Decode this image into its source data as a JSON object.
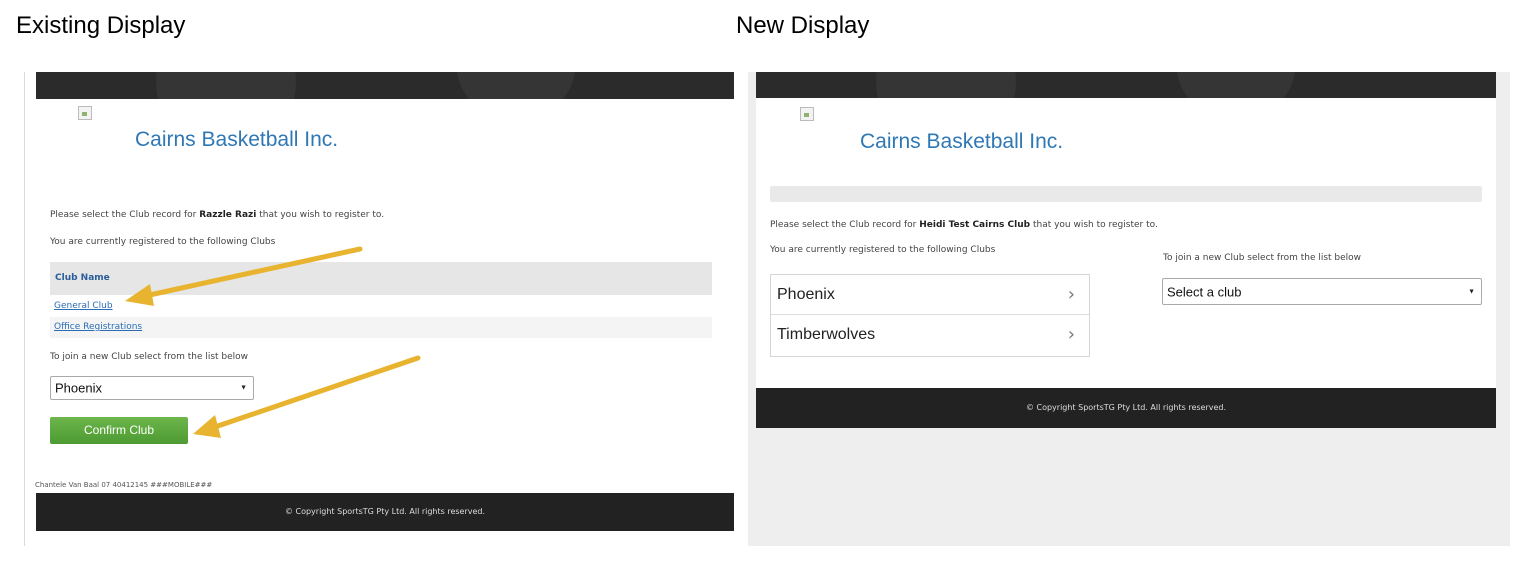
{
  "captions": {
    "left": "Existing Display",
    "right": "New Display"
  },
  "existing": {
    "brand": "Cairns Basketball Inc.",
    "intro_prefix": "Please select the Club record for ",
    "intro_name": "Razzle Razi",
    "intro_suffix": " that you wish to register to.",
    "registered_text": "You are currently registered to the following Clubs",
    "table_header": "Club Name",
    "clubs": [
      "General Club",
      "Office Registrations"
    ],
    "join_text": "To join a new Club select from the list below",
    "select_value": "Phoenix",
    "confirm_label": "Confirm Club",
    "contact_line": "Chantele Van Baal 07 40412145 ###MOBILE###",
    "footer": "© Copyright SportsTG Pty Ltd. All rights reserved.",
    "arrow_color": "#e8b32f"
  },
  "new": {
    "brand": "Cairns Basketball Inc.",
    "intro_prefix": "Please select the Club record for ",
    "intro_name": "Heidi Test Cairns Club",
    "intro_suffix": " that you wish to register to.",
    "registered_text": "You are currently registered to the following Clubs",
    "join_text": "To join a new Club select from the list below",
    "clubs": [
      "Phoenix",
      "Timberwolves"
    ],
    "select_placeholder": "Select a club",
    "footer": "© Copyright SportsTG Pty Ltd. All rights reserved."
  },
  "icons": {
    "broken_image": "broken-image-icon",
    "chevron": "chevron-right-icon",
    "dropdown": "dropdown-caret-icon",
    "copyright": "©"
  }
}
